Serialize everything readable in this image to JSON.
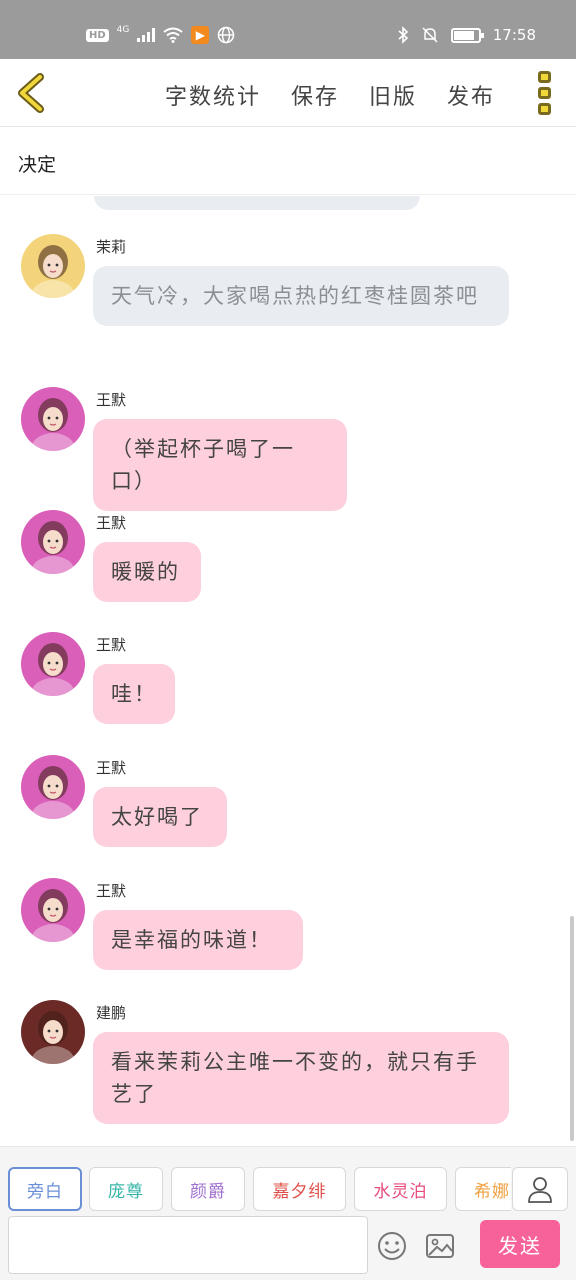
{
  "status_bar": {
    "hd": "HD",
    "network": "4G",
    "time": "17:58",
    "battery_level": 0.85
  },
  "toolbar": {
    "word_count": "字数统计",
    "save": "保存",
    "old_version": "旧版",
    "publish": "发布"
  },
  "decision": "决定",
  "messages": [
    {
      "name": "茉莉",
      "text": "天气冷，大家喝点热的红枣桂圆茶吧",
      "style": "gray",
      "avatar_color": "#f4d47a"
    },
    {
      "name": "王默",
      "text": "（举起杯子喝了一口）",
      "style": "pink",
      "avatar_color": "#d95fb8"
    },
    {
      "name": "王默",
      "text": "暖暖的",
      "style": "pink",
      "avatar_color": "#d95fb8"
    },
    {
      "name": "王默",
      "text": "哇！",
      "style": "pink",
      "avatar_color": "#d95fb8"
    },
    {
      "name": "王默",
      "text": "太好喝了",
      "style": "pink",
      "avatar_color": "#d95fb8"
    },
    {
      "name": "王默",
      "text": "是幸福的味道！",
      "style": "pink",
      "avatar_color": "#d95fb8"
    },
    {
      "name": "建鹏",
      "text": "看来茉莉公主唯一不变的，就只有手艺了",
      "style": "pink",
      "avatar_color": "#6b2a26"
    }
  ],
  "roles": [
    {
      "label": "旁白",
      "color": "#6a8fd6",
      "selected": true
    },
    {
      "label": "庞尊",
      "color": "#38b5a8",
      "selected": false
    },
    {
      "label": "颜爵",
      "color": "#a070d0",
      "selected": false
    },
    {
      "label": "嘉夕绯",
      "color": "#e0504a",
      "selected": false
    },
    {
      "label": "水灵泊",
      "color": "#e8487a",
      "selected": false
    },
    {
      "label": "希娜",
      "color": "#f0a040",
      "selected": false
    }
  ],
  "input": {
    "placeholder": ""
  },
  "send_label": "发送",
  "colors": {
    "accent": "#f8629a",
    "pink_bubble": "#fecfdc",
    "gray_bubble": "#e9edf2"
  }
}
